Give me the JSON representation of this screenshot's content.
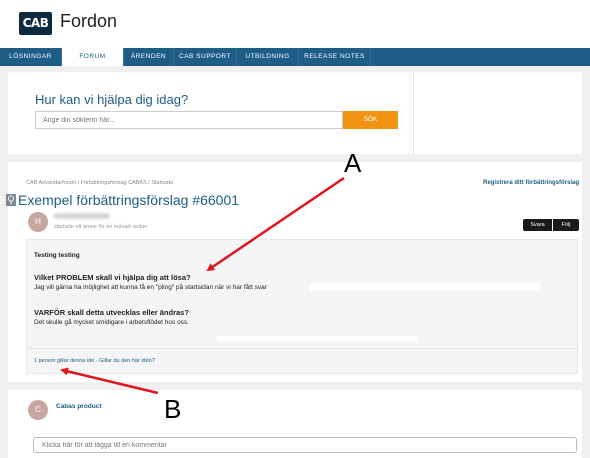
{
  "header": {
    "logo_text": "CAB",
    "title": "Fordon"
  },
  "nav": {
    "items": [
      {
        "label": "LÖSNINGAR",
        "active": false
      },
      {
        "label": "FORUM",
        "active": true
      },
      {
        "label": "ÄRENDEN",
        "active": false
      },
      {
        "label": "CAB SUPPORT",
        "active": false
      },
      {
        "label": "UTBILDNING",
        "active": false
      },
      {
        "label": "RELEASE NOTES",
        "active": false
      }
    ]
  },
  "hero": {
    "title": "Hur kan vi hjälpa dig idag?",
    "search_placeholder": "Ange din sökterm här...",
    "search_button": "SÖK"
  },
  "breadcrumb": {
    "text": "CAB Användarforum  /  Förbättringsförslag CABAS  /  Startsida"
  },
  "register_link": "Registrera ditt förbättringsförslag",
  "idea": {
    "title": "Exempel förbättringsförslag #66001",
    "author_initial": "H",
    "author_meta": "startade ett ämne för en månad sedan",
    "reply_button": "Svara",
    "follow_button": "Följ",
    "heading": "Testing testing",
    "q1": "Vilket PROBLEM skall vi hjälpa dig att lösa?",
    "a1": "Jag vill gärna ha möjlighet att kunna få en \"pling\" på startsidan när vi har fått svar",
    "q2": "VARFÖR skall detta utvecklas eller ändras?",
    "a2": "Det skulle gå mycket smidigare i arbetsflödet hos oss.",
    "likes_text": "1 person gillar denna idé · Gillar du den här idén?"
  },
  "comments": {
    "avatar_initial": "C",
    "author": "Cabas product",
    "placeholder": "Klicka här för att lägga till en kommentar"
  },
  "annotations": {
    "a": "A",
    "b": "B",
    "color": "#e0141e"
  },
  "colors": {
    "brand": "#1d5d86",
    "accent": "#f39314",
    "logo_bg": "#0e2a3f"
  }
}
